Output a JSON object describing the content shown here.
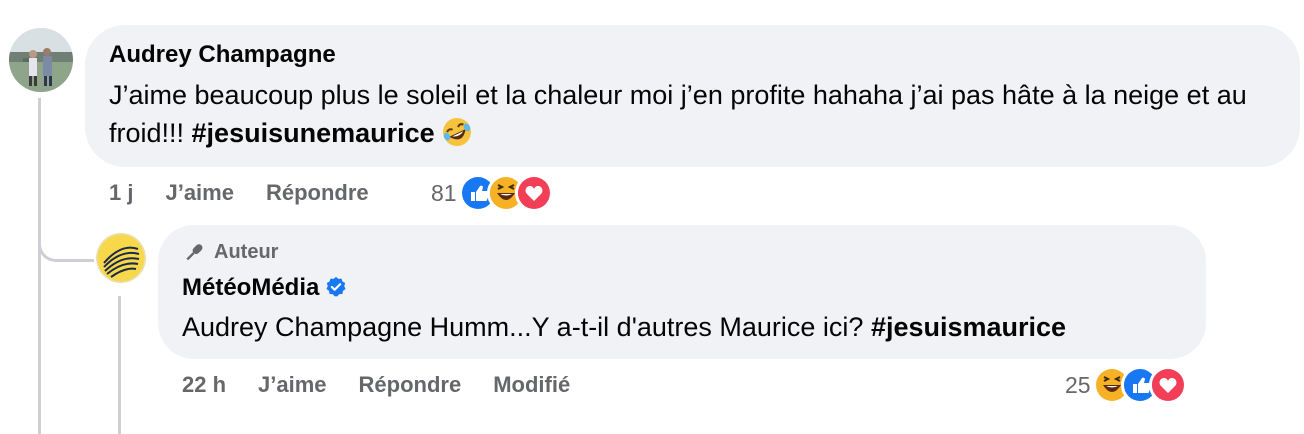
{
  "comment": {
    "author": "Audrey Champagne",
    "text": "J’aime beaucoup plus le soleil et la chaleur moi j’en profite hahaha j’ai pas hâte à la neige et au froid!!! ",
    "hashtag": "#jesuisunemaurice",
    "emoji": "rolling-on-floor-laughing",
    "time": "1 j",
    "like_label": "J’aime",
    "reply_label": "Répondre",
    "reaction_count": "81",
    "reactions": [
      "like",
      "haha",
      "love"
    ]
  },
  "reply": {
    "badge": "Auteur",
    "author": "MétéoMédia",
    "verified": true,
    "mention": "Audrey Champagne",
    "text": " Humm...Y a-t-il d'autres Maurice ici? ",
    "hashtag": "#jesuismaurice",
    "time": "22 h",
    "like_label": "J’aime",
    "reply_label": "Répondre",
    "edited_label": "Modifié",
    "reaction_count": "25",
    "reactions": [
      "haha",
      "like",
      "love"
    ]
  },
  "colors": {
    "bubble": "#f0f2f5",
    "muted": "#65676b",
    "like": "#1877f2",
    "love": "#f33e58",
    "haha": "#f7b125",
    "verified": "#1877f2"
  }
}
